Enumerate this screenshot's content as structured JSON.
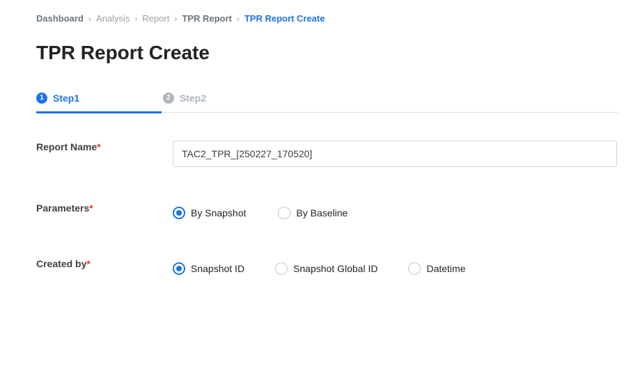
{
  "breadcrumb": {
    "items": [
      "Dashboard",
      "Analysis",
      "Report",
      "TPR Report",
      "TPR Report Create"
    ],
    "separator": "›"
  },
  "page_title": "TPR Report Create",
  "steps": [
    {
      "number": "1",
      "label": "Step1",
      "active": true
    },
    {
      "number": "2",
      "label": "Step2",
      "active": false
    }
  ],
  "form": {
    "report_name": {
      "label": "Report Name",
      "required_mark": "*",
      "value": "TAC2_TPR_[250227_170520]"
    },
    "parameters": {
      "label": "Parameters",
      "required_mark": "*",
      "options": [
        "By Snapshot",
        "By Baseline"
      ],
      "selected": "By Snapshot"
    },
    "created_by": {
      "label": "Created by",
      "required_mark": "*",
      "options": [
        "Snapshot ID",
        "Snapshot Global ID",
        "Datetime"
      ],
      "selected": "Snapshot ID"
    }
  },
  "colors": {
    "accent": "#1a73e8",
    "required": "#e53935"
  }
}
